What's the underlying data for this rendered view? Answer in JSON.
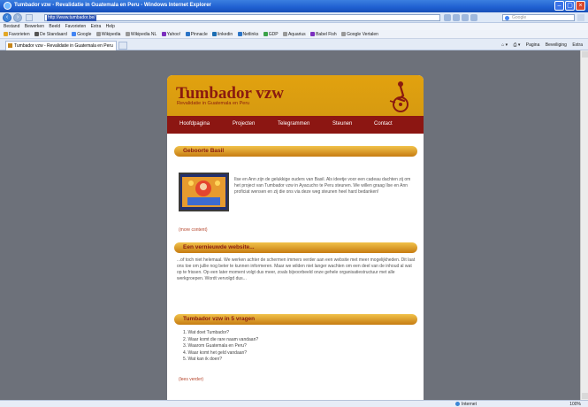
{
  "browser": {
    "window_title": "Tumbador vzw - Revalidatie in Guatemala en Peru - Windows Internet Explorer",
    "url": "http://www.tumbador.be/",
    "search_placeholder": "Google",
    "menu": [
      "Bestand",
      "Bewerken",
      "Beeld",
      "Favorieten",
      "Extra",
      "Help"
    ],
    "favorites": [
      {
        "label": "Favorieten"
      },
      {
        "label": "De Standaard"
      },
      {
        "label": "Google"
      },
      {
        "label": "Wikipedia"
      },
      {
        "label": "Wikipedia NL"
      },
      {
        "label": "Yahoo!"
      },
      {
        "label": "Pinnacle"
      },
      {
        "label": "linkedin"
      },
      {
        "label": "Netlinks"
      },
      {
        "label": "GDP"
      },
      {
        "label": "Aquarius"
      },
      {
        "label": "Babel Fish"
      },
      {
        "label": "Google Vertalen"
      }
    ],
    "tab_title": "Tumbador vzw - Revalidatie in Guatemala en Peru",
    "commands": [
      "Pagina",
      "Beveiliging",
      "Extra"
    ],
    "status_zone": "Internet",
    "status_zoom": "100%"
  },
  "site": {
    "title": "Tumbador vzw",
    "subtitle": "Revalidatie in Guatemala en Peru",
    "nav": [
      "Hoofdpagina",
      "Projecten",
      "Telegrammen",
      "Steunen",
      "Contact"
    ],
    "sections": [
      {
        "heading": "Geboorte Basil",
        "body": "Ilse en Ann zijn de gelukkige ouders van Basil. Als ideetje voor een cadeau dachten zij om het project van Tumbador vzw in Ayacucho te Peru steunen. We willen graag Ilse en Ann proficiat wensen en zij die ons via deze weg steunen heel hard bedanken!",
        "more": "(more content)"
      },
      {
        "heading": "Een vernieuwde website...",
        "body": "...of toch niet helemaal. We werken achter de schermen immers verder aan een website met meer mogelijkheden. Dit laat ons toe om jullie nog beter te kunnen informeren. Maar we wilden niet langer wachten om een deel van de inhoud al wat op te frissen. Op een later moment volgt dus meer, zoals bijvoorbeeld onze gehele organisatiestructuur met alle werkgroepen. Wordt vervolgd dus..."
      },
      {
        "heading": "Tumbador vzw in 5 vragen",
        "questions": [
          "1.  Wat doet Tumbador?",
          "2.  Waar komt die rare naam vandaan?",
          "3.  Waarom Guatemala en Peru?",
          "4.  Waar komt het geld vandaan?",
          "5.  Wat kan ik doen?"
        ],
        "more": "(lees verder)"
      }
    ]
  },
  "colors": {
    "header_gold": "#d69a10",
    "nav_red": "#8c1612",
    "title_red": "#8a1a10",
    "page_bg": "#6d717a"
  }
}
